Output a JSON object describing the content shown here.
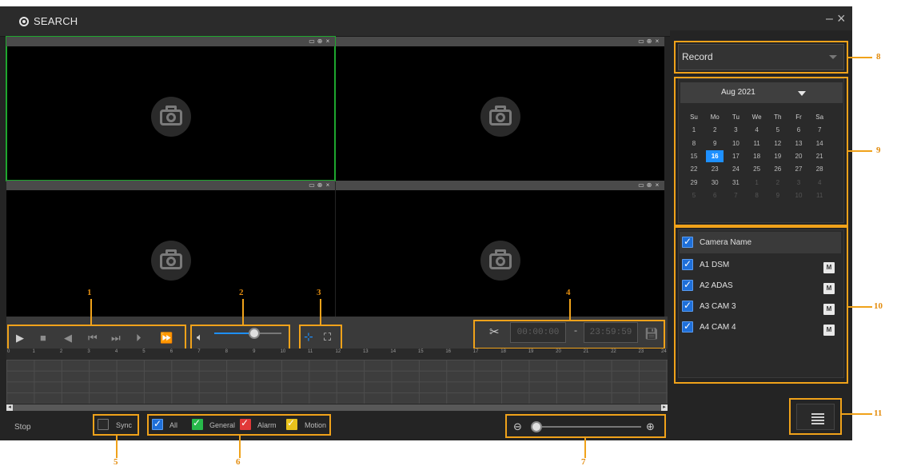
{
  "window": {
    "title": "SEARCH",
    "icon": "search-target-icon"
  },
  "video_panes": [
    {
      "tools": [
        "record-icon",
        "zoom-icon",
        "close-icon"
      ],
      "placeholder": "camera-icon"
    },
    {
      "tools": [
        "record-icon",
        "zoom-icon",
        "close-icon"
      ],
      "placeholder": "camera-icon"
    },
    {
      "tools": [
        "record-icon",
        "zoom-icon",
        "close-icon"
      ],
      "placeholder": "camera-icon"
    },
    {
      "tools": [
        "record-icon",
        "zoom-icon",
        "close-icon"
      ],
      "placeholder": "camera-icon"
    }
  ],
  "playback": {
    "buttons": [
      "play-icon",
      "stop-icon",
      "play-backward-icon",
      "previous-frame-icon",
      "next-frame-icon",
      "slow-play-icon",
      "fast-play-icon"
    ],
    "volume_level": 0.55
  },
  "clip": {
    "start_time": "00:00:00",
    "separator": "-",
    "end_time": "23:59:59"
  },
  "timeline": {
    "hours": [
      "0",
      "1",
      "2",
      "3",
      "4",
      "5",
      "6",
      "7",
      "8",
      "9",
      "10",
      "11",
      "12",
      "13",
      "14",
      "15",
      "16",
      "17",
      "18",
      "19",
      "20",
      "21",
      "22",
      "23",
      "24"
    ]
  },
  "status": {
    "text": "Stop"
  },
  "sync": {
    "label": "Sync",
    "checked": false
  },
  "filters": [
    {
      "label": "All",
      "color": "#1e6fd9",
      "checked": true
    },
    {
      "label": "General",
      "color": "#27b94a",
      "checked": true
    },
    {
      "label": "Alarm",
      "color": "#e13838",
      "checked": true
    },
    {
      "label": "Motion",
      "color": "#e8c21c",
      "checked": true
    }
  ],
  "record_type": {
    "selected": "Record"
  },
  "calendar": {
    "month_label": "Aug 2021",
    "weekdays": [
      "Su",
      "Mo",
      "Tu",
      "We",
      "Th",
      "Fr",
      "Sa"
    ],
    "days": [
      [
        "1",
        "2",
        "3",
        "4",
        "5",
        "6",
        "7"
      ],
      [
        "8",
        "9",
        "10",
        "11",
        "12",
        "13",
        "14"
      ],
      [
        "15",
        "16",
        "17",
        "18",
        "19",
        "20",
        "21"
      ],
      [
        "22",
        "23",
        "24",
        "25",
        "26",
        "27",
        "28"
      ],
      [
        "29",
        "30",
        "31",
        "1",
        "2",
        "3",
        "4"
      ],
      [
        "5",
        "6",
        "7",
        "8",
        "9",
        "10",
        "11"
      ]
    ],
    "selected_day": "16"
  },
  "cameras": {
    "header": "Camera Name",
    "items": [
      {
        "name": "A1 DSM",
        "badge": "M"
      },
      {
        "name": "A2 ADAS",
        "badge": "M"
      },
      {
        "name": "A3 CAM 3",
        "badge": "M"
      },
      {
        "name": "A4 CAM 4",
        "badge": "M"
      }
    ]
  },
  "callouts": [
    "1",
    "2",
    "3",
    "4",
    "5",
    "6",
    "7",
    "8",
    "9",
    "10",
    "11"
  ],
  "colors": {
    "accent": "#1e90ff",
    "callout": "#f0a21a",
    "active_pane": "#1ea62e"
  }
}
